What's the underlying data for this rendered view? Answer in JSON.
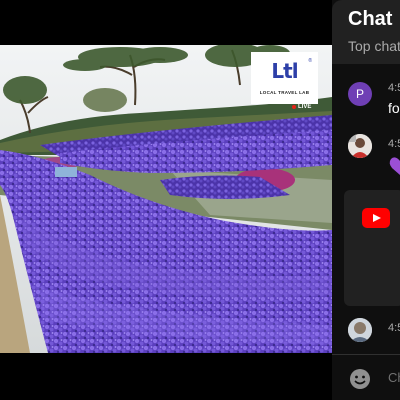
{
  "video": {
    "brand_mark": "Ltl",
    "brand_registered": "®",
    "brand_name": "LOCAL TRAVEL LAB",
    "live_label": "LIVE",
    "icons": {
      "scene": "flower-field-landscape"
    }
  },
  "chat": {
    "title": "Chat",
    "mode_label": "Top chat",
    "messages": [
      {
        "avatar_initial": "P",
        "avatar_color": "#6f3fb5",
        "time": "4:5",
        "text": "fo"
      },
      {
        "avatar": "user-photo",
        "time": "4:5",
        "emoji": "purple-heart"
      },
      {
        "avatar": "user-photo",
        "time": "4:5"
      }
    ],
    "promo": {
      "icon": "youtube-logo"
    },
    "input_placeholder": "Ch"
  },
  "colors": {
    "chat_background": "#0f0f0f",
    "header_background": "#212121",
    "youtube_red": "#ff0000",
    "flower_purple": "#6a4fc8",
    "live_red": "#e62117"
  }
}
